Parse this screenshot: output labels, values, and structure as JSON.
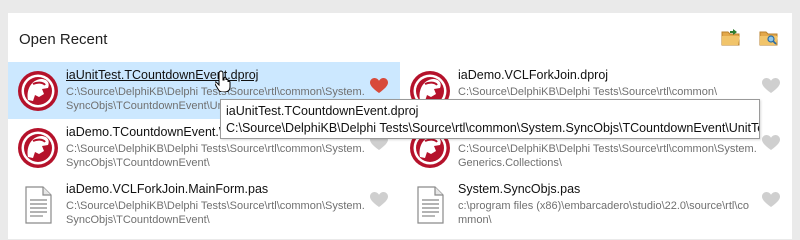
{
  "header": {
    "title": "Open Recent",
    "open_folder_icon": "open-folder-icon",
    "browse_folder_icon": "browse-folder-icon"
  },
  "items": [
    {
      "name": "iaUnitTest.TCountdownEvent.dproj",
      "path": "C:\\Source\\DelphiKB\\Delphi Tests\\Source\\rtl\\common\\System.SyncObjs\\TCountdownEvent\\UnitTest\\",
      "icon": "delphi-project-icon",
      "favorite": true,
      "selected": true
    },
    {
      "name": "iaDemo.VCLForkJoin.dproj",
      "path": "C:\\Source\\DelphiKB\\Delphi Tests\\Source\\rtl\\common\\",
      "icon": "delphi-project-icon",
      "favorite": false,
      "selected": false
    },
    {
      "name": "iaDemo.TCountdownEvent.WaitFor.dproj",
      "path": "C:\\Source\\DelphiKB\\Delphi Tests\\Source\\rtl\\common\\System.SyncObjs\\TCountdownEvent\\",
      "icon": "delphi-project-icon",
      "favorite": false,
      "selected": false
    },
    {
      "name": "iaDemo.ForkJoin.dproj",
      "path": "C:\\Source\\DelphiKB\\Delphi Tests\\Source\\rtl\\common\\System.Generics.Collections\\",
      "icon": "delphi-project-icon",
      "favorite": false,
      "selected": false
    },
    {
      "name": "iaDemo.VCLForkJoin.MainForm.pas",
      "path": "C:\\Source\\DelphiKB\\Delphi Tests\\Source\\rtl\\common\\System.SyncObjs\\TCountdownEvent\\",
      "icon": "document-icon",
      "favorite": false,
      "selected": false
    },
    {
      "name": "System.SyncObjs.pas",
      "path": "c:\\program files (x86)\\embarcadero\\studio\\22.0\\source\\rtl\\common\\",
      "icon": "document-icon",
      "favorite": false,
      "selected": false
    }
  ],
  "tooltip": {
    "line1": "iaUnitTest.TCountdownEvent.dproj",
    "line2": "C:\\Source\\DelphiKB\\Delphi Tests\\Source\\rtl\\common\\System.SyncObjs\\TCountdownEvent\\UnitTest\\"
  },
  "colors": {
    "selected_bg": "#cce8ff",
    "heart_active": "#d84a3a",
    "heart_inactive": "#cfcfcf",
    "delphi_red": "#b5122b"
  }
}
